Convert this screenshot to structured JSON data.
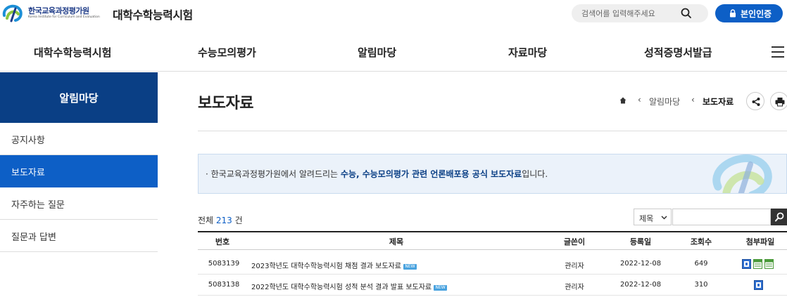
{
  "header": {
    "logo_ko": "한국교육과정평가원",
    "logo_en": "Korea Institute for Curriculum and Evaluation",
    "site_title": "대학수학능력시험",
    "search_placeholder": "검색어를 입력해주세요",
    "cert_label": "본인인증"
  },
  "gnb": {
    "items": [
      "대학수학능력시험",
      "수능모의평가",
      "알림마당",
      "자료마당",
      "성적증명서발급"
    ]
  },
  "sidebar": {
    "title": "알림마당",
    "items": [
      {
        "label": "공지사항",
        "active": false
      },
      {
        "label": "보도자료",
        "active": true
      },
      {
        "label": "자주하는 질문",
        "active": false
      },
      {
        "label": "질문과 답변",
        "active": false
      }
    ]
  },
  "main": {
    "title": "보도자료",
    "breadcrumb": [
      "알림마당",
      "보도자료"
    ],
    "notice": {
      "prefix": "· 한국교육과정평가원에서 알려드리는 ",
      "highlight": "수능, 수능모의평가 관련 언론배포용 공식 보도자료",
      "suffix": "입니다."
    },
    "count": {
      "prefix": "전체 ",
      "number": "213",
      "suffix": " 건"
    },
    "search_field": {
      "selected": "제목"
    },
    "table": {
      "headers": [
        "번호",
        "제목",
        "글쓴이",
        "등록일",
        "조회수",
        "첨부파일"
      ],
      "rows": [
        {
          "no": "5083139",
          "title": "2023학년도 대학수학능력시험 채점 결과 보도자료",
          "badge": "NEW",
          "author": "관리자",
          "date": "2022-12-08",
          "views": "649",
          "files": [
            "hwp",
            "xls",
            "xls"
          ]
        },
        {
          "no": "5083138",
          "title": "2022학년도 대학수학능력시험 성적 분석 결과 발표 보도자료",
          "badge": "NEW",
          "author": "관리자",
          "date": "2022-12-08",
          "views": "310",
          "files": [
            "hwp"
          ]
        }
      ]
    }
  },
  "colors": {
    "primary": "#0d5fc6",
    "navy": "#0a3f85",
    "notice_bg": "#ebf2fa",
    "count": "#0d5fc6"
  }
}
